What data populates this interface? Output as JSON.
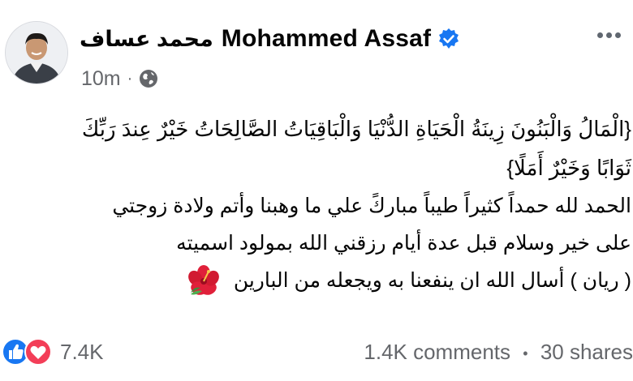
{
  "author": {
    "name_en": "Mohammed Assaf",
    "name_ar": "محمد عساف",
    "verified": true
  },
  "meta": {
    "timestamp": "10m",
    "separator": "·",
    "audience_icon": "globe-icon"
  },
  "post": {
    "lines": [
      "{الْمَالُ وَالْبَنُونَ زِينَةُ الْحَيَاةِ الدُّنْيَا وَالْبَاقِيَاتُ الصَّالِحَاتُ خَيْرٌ عِندَ رَبِّكَ",
      "ثَوَابًا وَخَيْرٌ أَمَلًا}",
      "الحمد لله حمداً كثيراً طيباً مباركً علي ما وهبنا وأتم ولادة زوجتي",
      "على خير وسلام  قبل عدة أيام رزقني الله بمولود اسميته",
      "( ريان ) أسال الله ان ينفعنا به ويجعله من البارين"
    ],
    "emoji": "hibiscus-flower-icon"
  },
  "footer": {
    "reaction_icons": [
      "like-icon",
      "love-icon"
    ],
    "reaction_count": "7.4K",
    "comments": "1.4K comments",
    "separator": "•",
    "shares": "30 shares"
  },
  "colors": {
    "like_blue": "#1877f2",
    "love_red": "#f33e58",
    "secondary_text": "#65676b",
    "primary_text": "#050505"
  }
}
